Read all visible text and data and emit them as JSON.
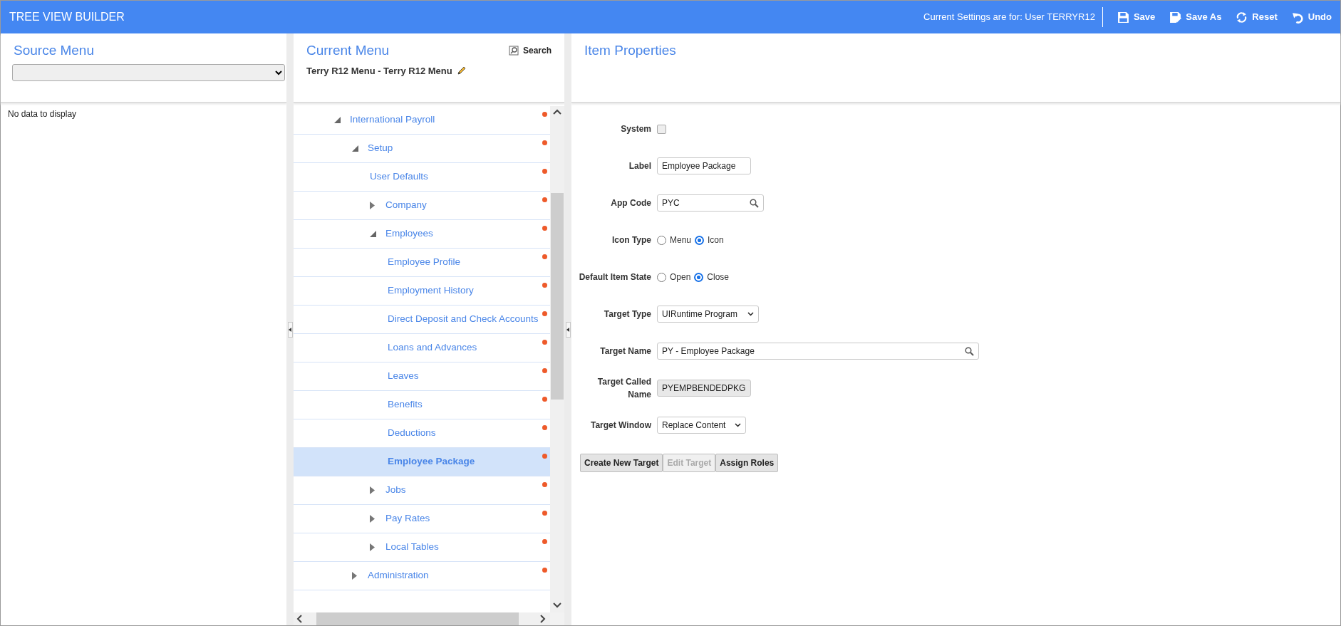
{
  "header": {
    "title": "TREE VIEW BUILDER",
    "settings_text": "Current Settings are for: User TERRYR12",
    "actions": [
      {
        "kind": "save",
        "label": "Save"
      },
      {
        "kind": "saveas",
        "label": "Save As"
      },
      {
        "kind": "reset",
        "label": "Reset"
      },
      {
        "kind": "undo",
        "label": "Undo"
      }
    ]
  },
  "source_menu": {
    "title": "Source Menu",
    "empty_text": "No data to display"
  },
  "current_menu": {
    "title": "Current Menu",
    "search_label": "Search",
    "menu_name": "Terry R12 Menu - Terry R12 Menu",
    "tree": [
      {
        "label": "International Payroll",
        "expanded": true,
        "selected": false,
        "children": [
          {
            "label": "Setup",
            "expanded": true,
            "selected": false,
            "children": [
              {
                "label": "User Defaults",
                "selected": false
              },
              {
                "label": "Company",
                "expanded": false,
                "selected": false
              },
              {
                "label": "Employees",
                "expanded": true,
                "selected": false,
                "children": [
                  {
                    "label": "Employee Profile",
                    "selected": false
                  },
                  {
                    "label": "Employment History",
                    "selected": false
                  },
                  {
                    "label": "Direct Deposit and Check Accounts",
                    "selected": false
                  },
                  {
                    "label": "Loans and Advances",
                    "selected": false
                  },
                  {
                    "label": "Leaves",
                    "selected": false
                  },
                  {
                    "label": "Benefits",
                    "selected": false
                  },
                  {
                    "label": "Deductions",
                    "selected": false
                  },
                  {
                    "label": "Employee Package",
                    "selected": true
                  }
                ]
              },
              {
                "label": "Jobs",
                "expanded": false,
                "selected": false
              },
              {
                "label": "Pay Rates",
                "expanded": false,
                "selected": false
              },
              {
                "label": "Local Tables",
                "expanded": false,
                "selected": false
              }
            ]
          },
          {
            "label": "Administration",
            "expanded": false,
            "selected": false
          }
        ]
      }
    ]
  },
  "item_properties": {
    "title": "Item Properties",
    "fields": [
      {
        "kind": "checkbox",
        "label": "System",
        "checked": false
      },
      {
        "kind": "text",
        "label": "Label",
        "value": "Employee Package"
      },
      {
        "kind": "lookup",
        "label": "App Code",
        "value": "PYC"
      },
      {
        "kind": "radio",
        "label": "Icon Type",
        "options": [
          {
            "label": "Menu",
            "selected": false
          },
          {
            "label": "Icon",
            "selected": true
          }
        ]
      },
      {
        "kind": "radio",
        "label": "Default Item State",
        "options": [
          {
            "label": "Open",
            "selected": false
          },
          {
            "label": "Close",
            "selected": true
          }
        ]
      },
      {
        "kind": "select",
        "label": "Target Type",
        "value": "UIRuntime Program"
      },
      {
        "kind": "lookup",
        "label": "Target Name",
        "value": "PY - Employee Package"
      },
      {
        "kind": "readonly",
        "label": "Target Called Name",
        "value": "PYEMPBENDEDPKG"
      },
      {
        "kind": "select",
        "label": "Target Window",
        "value": "Replace Content"
      }
    ],
    "buttons": [
      {
        "label": "Create New Target",
        "disabled": false
      },
      {
        "label": "Edit Target",
        "disabled": true
      },
      {
        "label": "Assign Roles",
        "disabled": false
      }
    ]
  }
}
